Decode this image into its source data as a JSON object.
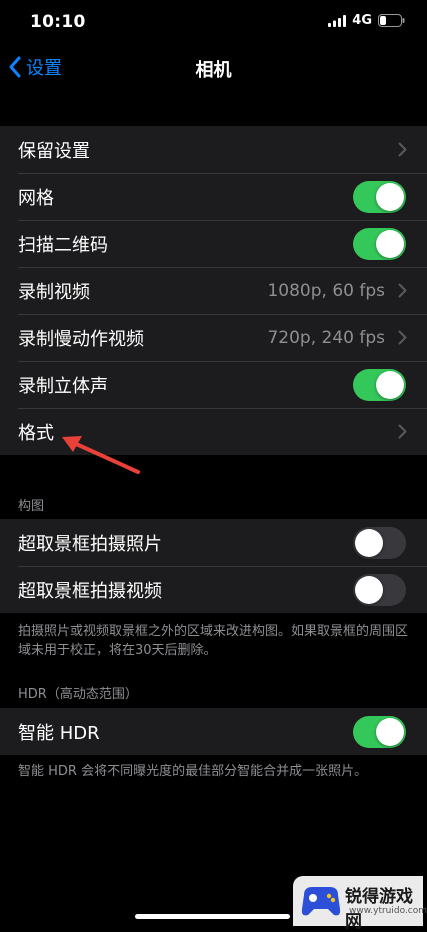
{
  "status_bar": {
    "time": "10:10",
    "network": "4G"
  },
  "nav": {
    "back_label": "设置",
    "title": "相机"
  },
  "group1": {
    "preserve_settings": "保留设置",
    "grid": "网格",
    "scan_qr": "扫描二维码",
    "record_video": "录制视频",
    "record_video_value": "1080p, 60 fps",
    "record_slomo": "录制慢动作视频",
    "record_slomo_value": "720p, 240 fps",
    "record_stereo": "录制立体声",
    "formats": "格式"
  },
  "toggles": {
    "grid": true,
    "scan_qr": true,
    "record_stereo": true,
    "photo_outside_frame": false,
    "video_outside_frame": false,
    "smart_hdr": true
  },
  "composition": {
    "header": "构图",
    "photo_outside_frame": "超取景框拍摄照片",
    "video_outside_frame": "超取景框拍摄视频",
    "footer": "拍摄照片或视频取景框之外的区域来改进构图。如果取景框的周围区域未用于校正，将在30天后删除。"
  },
  "hdr": {
    "header": "HDR（高动态范围）",
    "smart_hdr": "智能 HDR",
    "footer": "智能 HDR 会将不同曝光度的最佳部分智能合并成一张照片。"
  },
  "watermark": {
    "text": "锐得游戏网",
    "url": "www.ytruido.com"
  },
  "colors": {
    "accent": "#0a84ff",
    "toggle_on": "#34c759",
    "annotation_arrow": "#e8413a"
  }
}
